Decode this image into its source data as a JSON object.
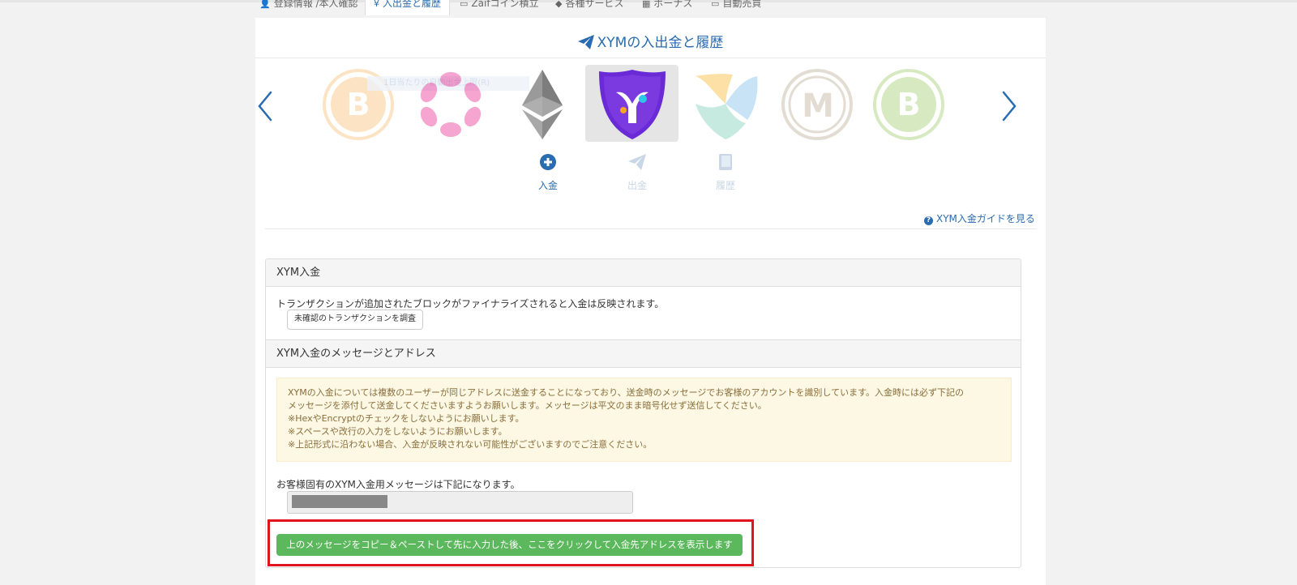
{
  "tabs": [
    {
      "icon": "user-icon",
      "glyph": "👤",
      "label": "登録情報 /本人確認"
    },
    {
      "icon": "yen-icon",
      "glyph": "¥",
      "label": "入出金と履歴"
    },
    {
      "icon": "wallet-icon",
      "glyph": "▭",
      "label": "Zaifコイン積立"
    },
    {
      "icon": "tags-icon",
      "glyph": "◆",
      "label": "各種サービス"
    },
    {
      "icon": "grid-icon",
      "glyph": "▦",
      "label": "ボーナス"
    },
    {
      "icon": "robot-icon",
      "glyph": "▭",
      "label": "自動売買"
    }
  ],
  "page": {
    "title": "XYMの入出金と履歴"
  },
  "carousel": {
    "ghost_text": "1日当たりの自動出金上限(R)",
    "coins": [
      {
        "name": "bitcoin",
        "color": "#f7931a",
        "selected": false,
        "faded": true
      },
      {
        "name": "polkadot",
        "color": "#e6007a",
        "selected": false,
        "faded": true
      },
      {
        "name": "ethereum",
        "color": "#8c8c8c",
        "selected": false,
        "faded": false
      },
      {
        "name": "symbol",
        "color": "#6a2bd6",
        "selected": true,
        "faded": false
      },
      {
        "name": "nem",
        "color": "#67b2e8",
        "selected": false,
        "faded": true
      },
      {
        "name": "monacoin",
        "color": "#a58f70",
        "selected": false,
        "faded": true
      },
      {
        "name": "bitcoin-cash",
        "color": "#8dc351",
        "selected": false,
        "faded": true
      }
    ]
  },
  "actions": [
    {
      "label": "入金",
      "icon": "plus-circle-icon",
      "active": true
    },
    {
      "label": "出金",
      "icon": "paper-plane-icon",
      "active": false
    },
    {
      "label": "履歴",
      "icon": "book-icon",
      "active": false
    }
  ],
  "guide_link": "XYM入金ガイドを見る",
  "panel": {
    "heading1": "XYM入金",
    "info_text": "トランザクションが追加されたブロックがファイナライズされると入金は反映されます。",
    "request_button": "未確認のトランザクションを調査",
    "heading2": "XYM入金のメッセージとアドレス",
    "warning_lines": [
      "XYMの入金については複数のユーザーが同じアドレスに送金することになっており、送金時のメッセージでお客様のアカウントを識別しています。入金時には必ず下記の",
      "メッセージを添付して送金してくださいますようお願いします。メッセージは平文のまま暗号化せず送信してください。",
      "※HexやEncryptのチェックをしないようにお願いします。",
      "※スペースや改行の入力をしないようにお願いします。",
      "※上記形式に沿わない場合、入金が反映されない可能性がございますのでご注意ください。"
    ],
    "message_label": "お客様固有のXYM入金用メッセージは下記になります。",
    "show_address_button": "上のメッセージをコピー＆ペーストして先に入力した後、ここをクリックして入金先アドレスを表示します"
  },
  "colors": {
    "link": "#2a6cb0",
    "success": "#5cb85c",
    "highlight": "#e0141e",
    "warning_bg": "#fcf8e3"
  }
}
